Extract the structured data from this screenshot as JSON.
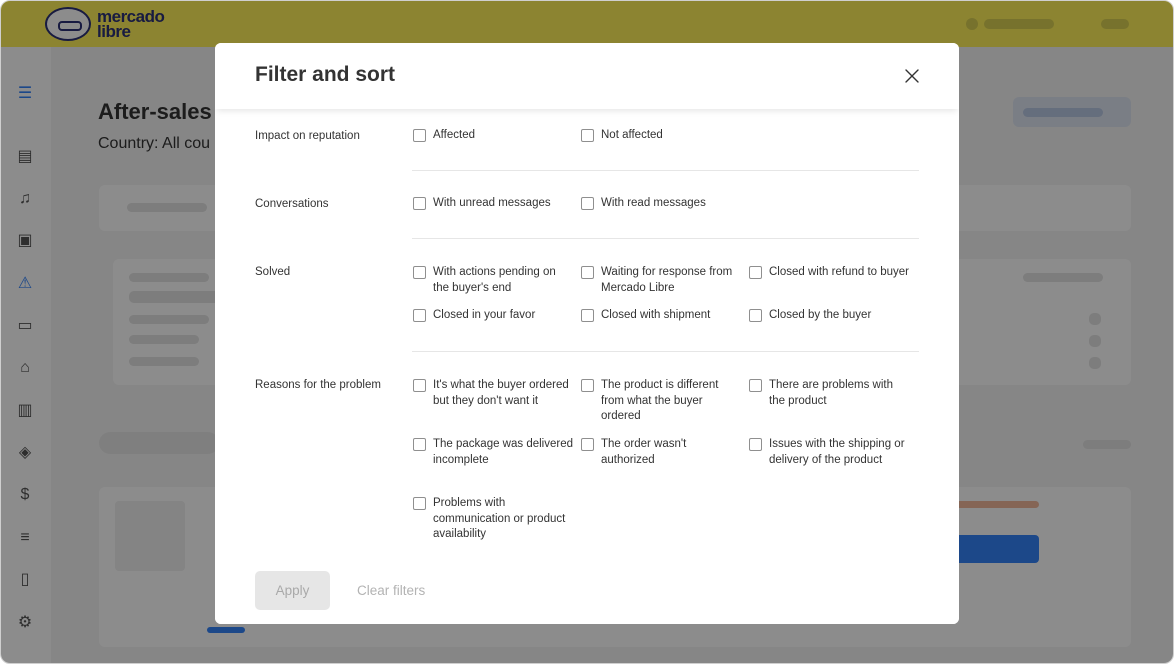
{
  "app": {
    "logo_line1": "mercado",
    "logo_line2": "libre",
    "page_title": "After-sales m",
    "page_subtitle": "Country: All cou"
  },
  "sidebar": {
    "icons": [
      "menu-icon",
      "list-icon",
      "bell-icon",
      "box-icon",
      "claims-icon",
      "chat-icon",
      "store-icon",
      "bar-chart-icon",
      "badge-icon",
      "money-icon",
      "receipt-icon",
      "document-icon",
      "gear-icon"
    ]
  },
  "modal": {
    "title": "Filter and sort",
    "sections": [
      {
        "label": "Impact on reputation",
        "options": [
          "Affected",
          "Not affected"
        ]
      },
      {
        "label": "Conversations",
        "options": [
          "With unread messages",
          "With read messages"
        ]
      },
      {
        "label": "Solved",
        "options": [
          "With actions pending on the buyer's end",
          "Waiting for response from Mercado Libre",
          "Closed with refund to buyer",
          "Closed in your favor",
          "Closed with shipment",
          "Closed by the buyer"
        ]
      },
      {
        "label": "Reasons for the problem",
        "options": [
          "It's what the buyer ordered but they don't want it",
          "The product is different from what the buyer ordered",
          "There are problems with the product",
          "The package was delivered incomplete",
          "The order wasn't authorized",
          "Issues with the shipping or delivery of the product",
          "Problems with communication or product availability"
        ]
      }
    ],
    "footer": {
      "apply_label": "Apply",
      "clear_label": "Clear filters"
    }
  }
}
